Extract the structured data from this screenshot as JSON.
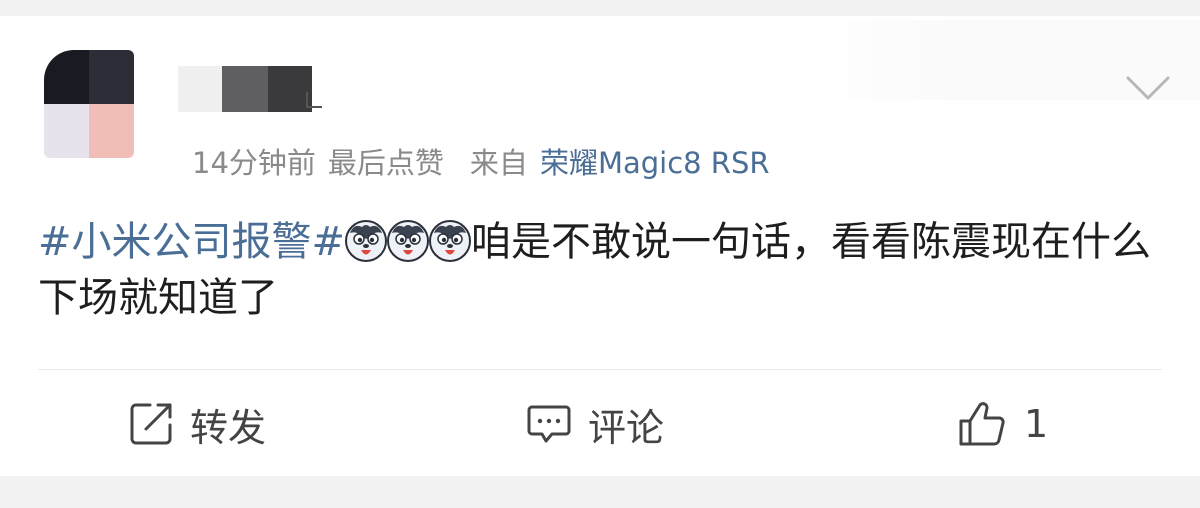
{
  "post": {
    "time_text": "14分钟前",
    "last_liked": "最后点赞",
    "from_prefix": "来自",
    "device": "荣耀Magic8 RSR",
    "topic": "#小米公司报警#",
    "emoji_name": "husky-emoji",
    "emoji_count": 3,
    "text_after_emoji": "咱是不敢说一句话，看看陈震现在什么下场就知道了"
  },
  "actions": {
    "share_label": "转发",
    "comment_label": "评论",
    "like_count": "1"
  },
  "colors": {
    "link": "#4a6e96",
    "meta": "#8a8a8a",
    "text": "#1e1e1e"
  }
}
